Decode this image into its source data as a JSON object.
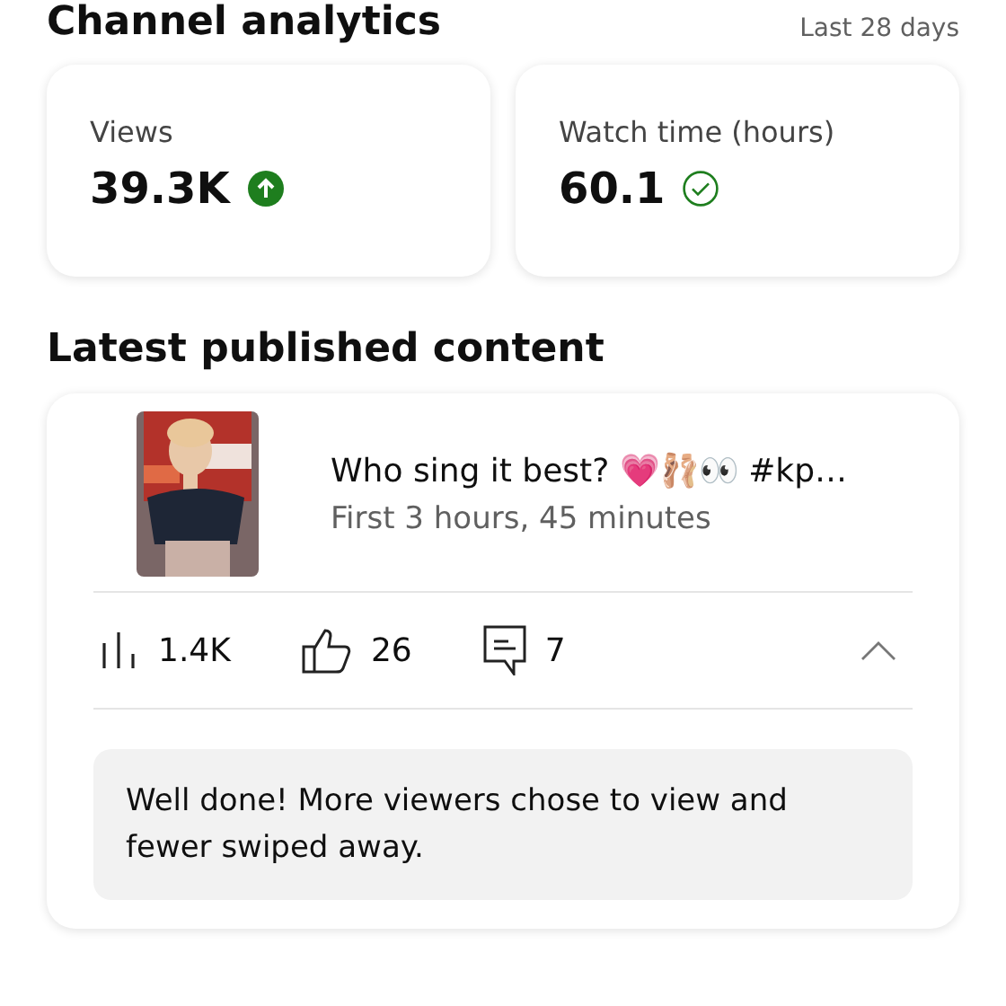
{
  "header": {
    "title": "Channel analytics",
    "period": "Last 28 days"
  },
  "metrics": [
    {
      "label": "Views",
      "value": "39.3K",
      "kind": "up"
    },
    {
      "label": "Watch time (hours)",
      "value": "60.1",
      "kind": "check"
    }
  ],
  "latest": {
    "title": "Latest published content",
    "item": {
      "title": "Who sing it best? 💗🩰👀 #kp…",
      "subtitle": "First 3 hours, 45 minutes",
      "stats": [
        {
          "kind": "views",
          "value": "1.4K"
        },
        {
          "kind": "likes",
          "value": "26"
        },
        {
          "kind": "comments",
          "value": "7"
        }
      ],
      "expanded": true,
      "message": "Well done! More viewers chose to view and fewer swiped away."
    }
  }
}
